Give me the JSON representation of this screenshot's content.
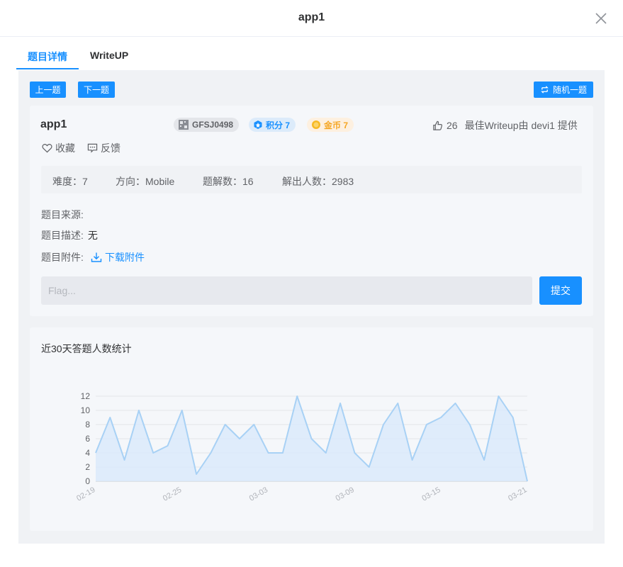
{
  "window": {
    "title": "app1"
  },
  "tabs": [
    {
      "label": "题目详情",
      "active": true
    },
    {
      "label": "WriteUP",
      "active": false
    }
  ],
  "nav": {
    "prev_label": "上一题",
    "next_label": "下一题",
    "random_label": "随机一题"
  },
  "problem": {
    "name": "app1",
    "tags": {
      "id": "GFSJ0498",
      "points_label": "积分 7",
      "coins_label": "金币 7"
    },
    "likes": "26",
    "best_writeup": "最佳Writeup由 devi1 提供",
    "favorite_label": "收藏",
    "feedback_label": "反馈",
    "stats": {
      "difficulty": "难度：7",
      "direction": "方向：Mobile",
      "writeups": "题解数：16",
      "solvers": "解出人数：2983"
    },
    "source_label": "题目来源:",
    "description_label": "题目描述:",
    "description_value": "无",
    "attachment_label": "题目附件:",
    "download_label": "下载附件",
    "flag_placeholder": "Flag...",
    "submit_label": "提交"
  },
  "colors": {
    "accent": "#1890ff",
    "panel_bg": "#f0f2f5",
    "card_bg": "#f5f7fa",
    "line": "#a8d1f5",
    "area": "#d9e9fb"
  },
  "chart_title": "近30天答题人数统计",
  "chart_data": {
    "type": "area",
    "title": "近30天答题人数统计",
    "x": [
      "02-19",
      "02-20",
      "02-21",
      "02-22",
      "02-23",
      "02-24",
      "02-25",
      "02-26",
      "02-27",
      "02-28",
      "03-01",
      "03-02",
      "03-03",
      "03-04",
      "03-05",
      "03-06",
      "03-07",
      "03-08",
      "03-09",
      "03-10",
      "03-11",
      "03-12",
      "03-13",
      "03-14",
      "03-15",
      "03-16",
      "03-17",
      "03-18",
      "03-19",
      "03-20",
      "03-21"
    ],
    "x_tick_labels": [
      "02-19",
      "02-25",
      "03-03",
      "03-09",
      "03-15",
      "03-21"
    ],
    "values": [
      4,
      9,
      3,
      10,
      4,
      5,
      10,
      1,
      4,
      8,
      6,
      8,
      4,
      4,
      12,
      6,
      4,
      11,
      4,
      2,
      8,
      11,
      3,
      8,
      9,
      11,
      8,
      3,
      12,
      9,
      0
    ],
    "y_ticks": [
      0,
      2,
      4,
      6,
      8,
      10,
      12
    ],
    "ylim": [
      0,
      12
    ],
    "xlabel": "",
    "ylabel": "",
    "grid": true
  }
}
